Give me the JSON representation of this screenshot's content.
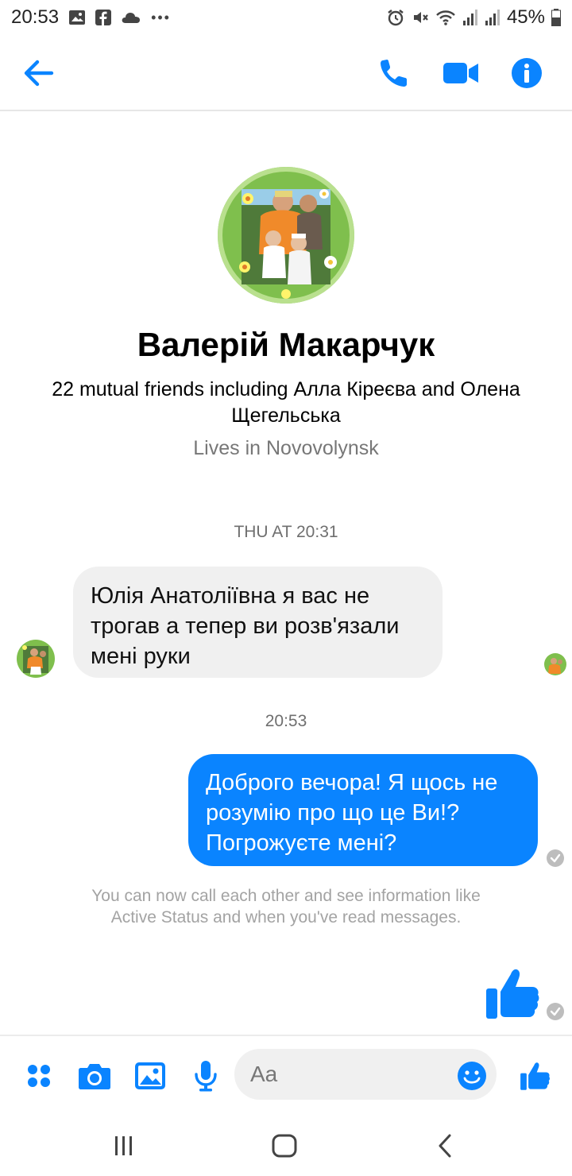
{
  "status_bar": {
    "time": "20:53",
    "dots": "•••",
    "battery": "45%"
  },
  "profile": {
    "name": "Валерій Макарчук",
    "mutual": "22 mutual friends including Алла Кіреєва and Олена Щегельська",
    "lives": "Lives in Novovolynsk"
  },
  "messages": {
    "time1": "THU AT 20:31",
    "incoming_text": "Юлія Анатоліївна я вас не трогав а тепер ви розв'язали мені руки",
    "time2": "20:53",
    "outgoing_text": "Доброго вечора! Я щось не розумію про що це Ви!? Погрожуєте мені?",
    "info_note": "You can now call each other and see information like Active Status and when you've read messages."
  },
  "composer": {
    "placeholder": "Aa"
  },
  "colors": {
    "accent": "#0a84ff",
    "incoming_bubble": "#f0f0f0"
  },
  "icons": [
    "back-arrow-icon",
    "phone-icon",
    "video-camera-icon",
    "info-icon",
    "menu-dots-icon",
    "camera-icon",
    "gallery-icon",
    "microphone-icon",
    "emoji-icon",
    "thumbs-up-icon"
  ]
}
